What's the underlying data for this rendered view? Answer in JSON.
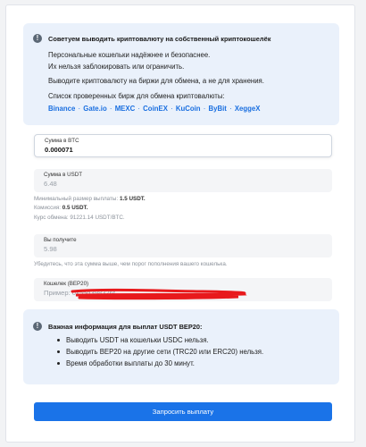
{
  "top_notice": {
    "title": "Советуем выводить криптовалюту на собственный криптокошелёк",
    "lines": [
      "Персональные кошельки надёжнее и безопаснее.",
      "Их нельзя заблокировать или ограничить.",
      "Выводите криптовалюту на биржи для обмена, а не для хранения.",
      "Список проверенных бирж для обмена криптовалюты:"
    ],
    "exchanges": [
      "Binance",
      "Gate.io",
      "MEXC",
      "CoinEX",
      "KuCoin",
      "ByBit",
      "XeggeX"
    ],
    "separator": "·"
  },
  "amount_btc": {
    "label": "Сумма в BTC",
    "value": "0.000071"
  },
  "amount_usdt": {
    "label": "Сумма в USDT",
    "value": "6.48"
  },
  "payout_info": {
    "min_prefix": "Минимальный размер выплаты: ",
    "min_value": "1.5 USDT.",
    "fee_prefix": "Комиссия: ",
    "fee_value": "0.5 USDT.",
    "rate": "Курс обмена: 91221.14 USDT/BTC."
  },
  "receive": {
    "label": "Вы получите",
    "value": "5.98",
    "hint": "Убедитесь, что эта сумма выше, чем порог пополнения вашего кошелька."
  },
  "wallet": {
    "label": "Кошелек (BEP20)",
    "placeholder": "Пример: 0x55d398326f"
  },
  "bottom_notice": {
    "title": "Важная информация для выплат USDT BEP20:",
    "bullets": [
      "Выводить USDT на кошельки USDC нельзя.",
      "Выводить BEP20 на другие сети (TRC20 или ERC20) нельзя.",
      "Время обработки выплаты до 30 минут."
    ]
  },
  "submit_label": "Запросить выплату",
  "colors": {
    "accent": "#1a73e8",
    "notice_bg": "#eaf1fb",
    "link": "#1a6fe0",
    "redaction": "#e8191c"
  }
}
